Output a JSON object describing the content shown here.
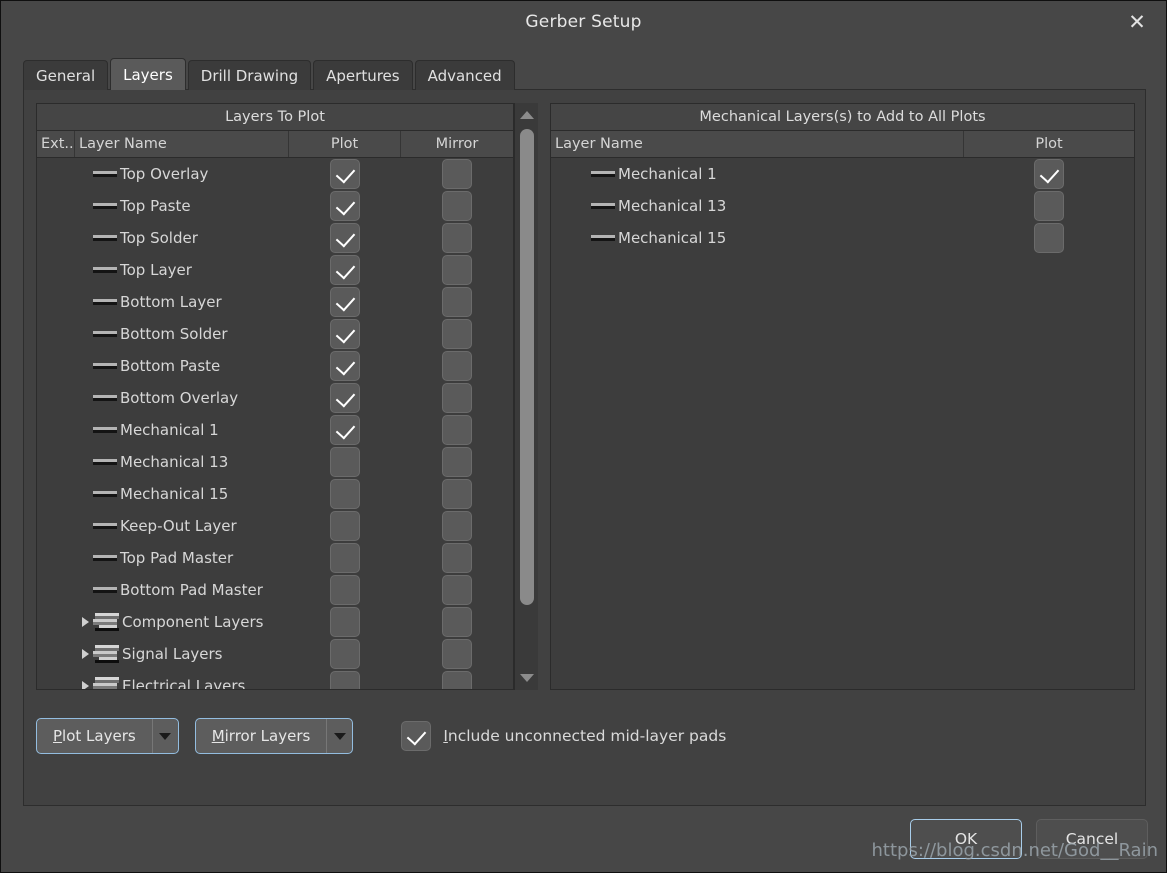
{
  "window": {
    "title": "Gerber Setup",
    "close_icon": "close-icon",
    "close_glyph": "✕"
  },
  "tabs": [
    {
      "label": "General",
      "active": false
    },
    {
      "label": "Layers",
      "active": true
    },
    {
      "label": "Drill Drawing",
      "active": false
    },
    {
      "label": "Apertures",
      "active": false
    },
    {
      "label": "Advanced",
      "active": false
    }
  ],
  "left_panel": {
    "caption": "Layers To Plot",
    "columns": [
      "Ext...",
      "Layer Name",
      "Plot",
      "Mirror"
    ],
    "rows": [
      {
        "name": "Top Overlay",
        "icon": "layer-color-line-icon",
        "group": false,
        "plot": true,
        "mirror": false
      },
      {
        "name": "Top Paste",
        "icon": "layer-color-line-icon",
        "group": false,
        "plot": true,
        "mirror": false
      },
      {
        "name": "Top Solder",
        "icon": "layer-color-line-icon",
        "group": false,
        "plot": true,
        "mirror": false
      },
      {
        "name": "Top Layer",
        "icon": "layer-color-line-icon",
        "group": false,
        "plot": true,
        "mirror": false
      },
      {
        "name": "Bottom Layer",
        "icon": "layer-color-line-icon",
        "group": false,
        "plot": true,
        "mirror": false
      },
      {
        "name": "Bottom Solder",
        "icon": "layer-color-line-icon",
        "group": false,
        "plot": true,
        "mirror": false
      },
      {
        "name": "Bottom Paste",
        "icon": "layer-color-line-icon",
        "group": false,
        "plot": true,
        "mirror": false
      },
      {
        "name": "Bottom Overlay",
        "icon": "layer-color-line-icon",
        "group": false,
        "plot": true,
        "mirror": false
      },
      {
        "name": "Mechanical 1",
        "icon": "layer-color-line-icon",
        "group": false,
        "plot": true,
        "mirror": false
      },
      {
        "name": "Mechanical 13",
        "icon": "layer-color-line-icon",
        "group": false,
        "plot": false,
        "mirror": false
      },
      {
        "name": "Mechanical 15",
        "icon": "layer-color-line-icon",
        "group": false,
        "plot": false,
        "mirror": false
      },
      {
        "name": "Keep-Out Layer",
        "icon": "layer-color-line-icon",
        "group": false,
        "plot": false,
        "mirror": false
      },
      {
        "name": "Top Pad Master",
        "icon": "layer-color-line-icon",
        "group": false,
        "plot": false,
        "mirror": false
      },
      {
        "name": "Bottom Pad Master",
        "icon": "layer-color-line-icon",
        "group": false,
        "plot": false,
        "mirror": false
      },
      {
        "name": "Component Layers",
        "icon": "layer-stack-icon",
        "group": true,
        "plot": false,
        "mirror": false
      },
      {
        "name": "Signal Layers",
        "icon": "layer-stack-icon",
        "group": true,
        "plot": false,
        "mirror": false
      },
      {
        "name": "Electrical Layers",
        "icon": "layer-stack-icon",
        "group": true,
        "plot": false,
        "mirror": false
      }
    ],
    "scrollbar": {
      "up_arrow_icon": "scroll-up-arrow-icon",
      "down_arrow_icon": "scroll-down-arrow-icon"
    }
  },
  "right_panel": {
    "caption": "Mechanical Layers(s) to Add to All Plots",
    "columns": [
      "Layer Name",
      "Plot"
    ],
    "rows": [
      {
        "name": "Mechanical 1",
        "icon": "layer-color-line-icon",
        "plot": true
      },
      {
        "name": "Mechanical 13",
        "icon": "layer-color-line-icon",
        "plot": false
      },
      {
        "name": "Mechanical 15",
        "icon": "layer-color-line-icon",
        "plot": false
      }
    ]
  },
  "bottom_controls": {
    "plot_layers": {
      "label_accel": "P",
      "label_rest": "lot Layers",
      "arrow_icon": "chevron-down-icon"
    },
    "mirror_layers": {
      "label_accel": "M",
      "label_rest": "irror Layers",
      "arrow_icon": "chevron-down-icon"
    },
    "include_pads": {
      "checked": true,
      "label_accel": "I",
      "label_rest": "nclude unconnected mid-layer pads"
    }
  },
  "footer": {
    "ok_label": "OK",
    "cancel_label": "Cancel"
  },
  "watermark": {
    "text": "https://blog.csdn.net/God__Rain"
  },
  "colors": {
    "dialog_bg": "#474747",
    "panel_bg": "#3d3d3d",
    "header_bg": "#4a4a4a",
    "tab_active_bg": "#5a5a5a",
    "accent_focus": "#93bde0",
    "text": "#d7d7d7"
  }
}
